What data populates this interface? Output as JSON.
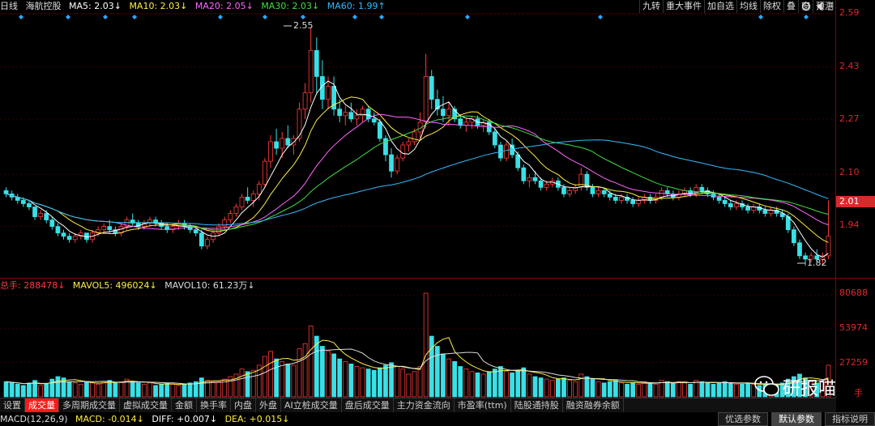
{
  "header": {
    "period": "日线",
    "stock_name": "海航控股",
    "ma5": "MA5: 2.03↓",
    "ma10": "MA10: 2.03↓",
    "ma20": "MA20: 2.05↓",
    "ma30": "MA30: 2.03↓",
    "ma60": "MA60: 1.99↑"
  },
  "tools": [
    "九转",
    "重大事件",
    "加自选",
    "均线",
    "除权",
    "叠",
    "窗",
    "预测"
  ],
  "price_axis": [
    "2.59",
    "2.43",
    "2.27",
    "2.10",
    "1.94"
  ],
  "current_price": "2.01",
  "annotations": {
    "high": "2.55",
    "low": "1.82"
  },
  "volume_header": {
    "total": "总手: 288478↓",
    "mavol5": "MAVOL5: 496024↓",
    "mavol10": "MAVOL10: 61.23万↓"
  },
  "volume_axis": [
    "80688",
    "53974",
    "27259",
    "手"
  ],
  "tabs": [
    "设置",
    "成交量",
    "多周期成交量",
    "虚拟成交量",
    "金额",
    "换手率",
    "内盘",
    "外盘",
    "AI立桩成交量",
    "盘后成交量",
    "主力资金流向",
    "市盈率(ttm)",
    "陆股通持股",
    "融资融券余额"
  ],
  "active_tab": "成交量",
  "macd": {
    "label": "MACD(12,26,9)",
    "macd": "MACD: -0.014↓",
    "diff": "DIFF: +0.007↓",
    "dea": "DEA: +0.015↓"
  },
  "bottom_buttons": [
    "优选参数",
    "默认参数",
    "指标说明"
  ],
  "watermark": "研报喵",
  "colors": {
    "up": "#ff3b3b",
    "down": "#39e0e6",
    "ma5": "#ffffff",
    "ma10": "#ffee44",
    "ma20": "#ff66ff",
    "ma30": "#44dd44",
    "ma60": "#33bbff"
  },
  "chart_data": {
    "type": "candlestick",
    "price_range": [
      1.8,
      2.59
    ],
    "volume_range": [
      0,
      82000
    ],
    "candles": [
      [
        2.05,
        2.06,
        2.03,
        2.04,
        12000
      ],
      [
        2.04,
        2.05,
        2.02,
        2.03,
        11000
      ],
      [
        2.03,
        2.04,
        2.01,
        2.02,
        10000
      ],
      [
        2.02,
        2.03,
        2.0,
        2.01,
        9000
      ],
      [
        2.01,
        2.02,
        1.99,
        2.0,
        11000
      ],
      [
        2.0,
        2.0,
        1.96,
        1.97,
        13000
      ],
      [
        1.97,
        1.99,
        1.96,
        1.98,
        9000
      ],
      [
        1.98,
        1.99,
        1.95,
        1.96,
        10000
      ],
      [
        1.96,
        1.97,
        1.93,
        1.94,
        14000
      ],
      [
        1.94,
        1.95,
        1.91,
        1.92,
        16000
      ],
      [
        1.92,
        1.93,
        1.9,
        1.91,
        15000
      ],
      [
        1.91,
        1.92,
        1.89,
        1.9,
        12000
      ],
      [
        1.9,
        1.92,
        1.89,
        1.91,
        11000
      ],
      [
        1.91,
        1.93,
        1.9,
        1.92,
        10000
      ],
      [
        1.92,
        1.92,
        1.89,
        1.9,
        12000
      ],
      [
        1.9,
        1.93,
        1.89,
        1.92,
        11000
      ],
      [
        1.92,
        1.94,
        1.91,
        1.93,
        10000
      ],
      [
        1.93,
        1.95,
        1.92,
        1.94,
        12000
      ],
      [
        1.94,
        1.96,
        1.92,
        1.93,
        13000
      ],
      [
        1.93,
        1.94,
        1.91,
        1.92,
        11000
      ],
      [
        1.92,
        1.95,
        1.91,
        1.94,
        12000
      ],
      [
        1.94,
        1.97,
        1.93,
        1.96,
        14000
      ],
      [
        1.96,
        1.98,
        1.94,
        1.95,
        12000
      ],
      [
        1.95,
        1.96,
        1.93,
        1.94,
        11000
      ],
      [
        1.94,
        1.96,
        1.93,
        1.95,
        10000
      ],
      [
        1.95,
        1.97,
        1.94,
        1.96,
        11000
      ],
      [
        1.96,
        1.97,
        1.94,
        1.95,
        9000
      ],
      [
        1.95,
        1.96,
        1.93,
        1.94,
        10000
      ],
      [
        1.94,
        1.95,
        1.92,
        1.93,
        11000
      ],
      [
        1.93,
        1.95,
        1.92,
        1.94,
        10000
      ],
      [
        1.94,
        1.96,
        1.93,
        1.95,
        9000
      ],
      [
        1.95,
        1.96,
        1.93,
        1.94,
        10000
      ],
      [
        1.94,
        1.95,
        1.92,
        1.93,
        11000
      ],
      [
        1.93,
        1.94,
        1.91,
        1.92,
        12000
      ],
      [
        1.92,
        1.93,
        1.87,
        1.88,
        15000
      ],
      [
        1.88,
        1.91,
        1.87,
        1.9,
        13000
      ],
      [
        1.9,
        1.93,
        1.89,
        1.92,
        12000
      ],
      [
        1.92,
        1.95,
        1.91,
        1.94,
        12000
      ],
      [
        1.94,
        1.97,
        1.93,
        1.96,
        14000
      ],
      [
        1.96,
        1.99,
        1.95,
        1.98,
        16000
      ],
      [
        1.98,
        2.01,
        1.97,
        2.0,
        18000
      ],
      [
        2.0,
        2.04,
        1.99,
        2.03,
        22000
      ],
      [
        2.03,
        2.06,
        2.01,
        2.02,
        20000
      ],
      [
        2.02,
        2.05,
        2.0,
        2.04,
        21000
      ],
      [
        2.04,
        2.08,
        2.02,
        2.07,
        25000
      ],
      [
        2.07,
        2.15,
        2.06,
        2.14,
        32000
      ],
      [
        2.14,
        2.22,
        2.12,
        2.2,
        36000
      ],
      [
        2.2,
        2.24,
        2.16,
        2.18,
        30000
      ],
      [
        2.18,
        2.23,
        2.15,
        2.21,
        28000
      ],
      [
        2.21,
        2.25,
        2.18,
        2.19,
        26000
      ],
      [
        2.19,
        2.22,
        2.16,
        2.21,
        25000
      ],
      [
        2.21,
        2.32,
        2.2,
        2.3,
        38000
      ],
      [
        2.3,
        2.38,
        2.27,
        2.35,
        42000
      ],
      [
        2.35,
        2.55,
        2.32,
        2.48,
        56000
      ],
      [
        2.48,
        2.52,
        2.35,
        2.4,
        48000
      ],
      [
        2.4,
        2.45,
        2.3,
        2.33,
        40000
      ],
      [
        2.33,
        2.4,
        2.3,
        2.37,
        36000
      ],
      [
        2.37,
        2.4,
        2.28,
        2.3,
        34000
      ],
      [
        2.3,
        2.33,
        2.26,
        2.28,
        30000
      ],
      [
        2.28,
        2.31,
        2.25,
        2.29,
        28000
      ],
      [
        2.29,
        2.32,
        2.26,
        2.27,
        26000
      ],
      [
        2.27,
        2.3,
        2.25,
        2.28,
        24000
      ],
      [
        2.28,
        2.31,
        2.26,
        2.3,
        23000
      ],
      [
        2.3,
        2.31,
        2.26,
        2.27,
        22000
      ],
      [
        2.27,
        2.29,
        2.25,
        2.26,
        21000
      ],
      [
        2.26,
        2.27,
        2.2,
        2.21,
        23000
      ],
      [
        2.21,
        2.22,
        2.14,
        2.16,
        25000
      ],
      [
        2.16,
        2.18,
        2.09,
        2.11,
        27000
      ],
      [
        2.11,
        2.16,
        2.1,
        2.15,
        24000
      ],
      [
        2.15,
        2.2,
        2.14,
        2.19,
        22000
      ],
      [
        2.19,
        2.21,
        2.17,
        2.2,
        18000
      ],
      [
        2.2,
        2.24,
        2.19,
        2.23,
        20000
      ],
      [
        2.23,
        2.29,
        2.21,
        2.26,
        24000
      ],
      [
        2.26,
        2.47,
        2.24,
        2.4,
        82000
      ],
      [
        2.4,
        2.42,
        2.3,
        2.33,
        48000
      ],
      [
        2.33,
        2.36,
        2.28,
        2.3,
        40000
      ],
      [
        2.3,
        2.34,
        2.26,
        2.28,
        34000
      ],
      [
        2.28,
        2.32,
        2.25,
        2.3,
        30000
      ],
      [
        2.3,
        2.31,
        2.26,
        2.27,
        28000
      ],
      [
        2.27,
        2.28,
        2.24,
        2.25,
        24000
      ],
      [
        2.25,
        2.27,
        2.23,
        2.26,
        22000
      ],
      [
        2.26,
        2.28,
        2.24,
        2.27,
        20000
      ],
      [
        2.27,
        2.28,
        2.24,
        2.25,
        19000
      ],
      [
        2.25,
        2.27,
        2.23,
        2.26,
        18000
      ],
      [
        2.26,
        2.27,
        2.22,
        2.23,
        20000
      ],
      [
        2.23,
        2.24,
        2.18,
        2.19,
        22000
      ],
      [
        2.19,
        2.2,
        2.14,
        2.15,
        24000
      ],
      [
        2.15,
        2.2,
        2.14,
        2.19,
        20000
      ],
      [
        2.19,
        2.21,
        2.15,
        2.16,
        19000
      ],
      [
        2.16,
        2.17,
        2.11,
        2.12,
        21000
      ],
      [
        2.12,
        2.13,
        2.07,
        2.08,
        23000
      ],
      [
        2.08,
        2.1,
        2.06,
        2.09,
        18000
      ],
      [
        2.09,
        2.11,
        2.07,
        2.08,
        16000
      ],
      [
        2.08,
        2.09,
        2.05,
        2.06,
        15000
      ],
      [
        2.06,
        2.08,
        2.05,
        2.07,
        14000
      ],
      [
        2.07,
        2.09,
        2.06,
        2.08,
        13000
      ],
      [
        2.08,
        2.09,
        2.05,
        2.06,
        14000
      ],
      [
        2.06,
        2.07,
        2.03,
        2.04,
        15000
      ],
      [
        2.04,
        2.06,
        2.03,
        2.05,
        13000
      ],
      [
        2.05,
        2.07,
        2.04,
        2.06,
        12000
      ],
      [
        2.06,
        2.12,
        2.05,
        2.1,
        18000
      ],
      [
        2.1,
        2.11,
        2.05,
        2.06,
        16000
      ],
      [
        2.06,
        2.07,
        2.03,
        2.04,
        14000
      ],
      [
        2.04,
        2.06,
        2.03,
        2.05,
        12000
      ],
      [
        2.05,
        2.06,
        2.03,
        2.04,
        11000
      ],
      [
        2.04,
        2.05,
        2.02,
        2.03,
        12000
      ],
      [
        2.03,
        2.04,
        2.01,
        2.02,
        13000
      ],
      [
        2.02,
        2.04,
        2.01,
        2.03,
        11000
      ],
      [
        2.03,
        2.04,
        2.01,
        2.02,
        10000
      ],
      [
        2.02,
        2.03,
        2.0,
        2.01,
        11000
      ],
      [
        2.01,
        2.03,
        2.0,
        2.02,
        10000
      ],
      [
        2.02,
        2.04,
        2.01,
        2.03,
        12000
      ],
      [
        2.03,
        2.04,
        2.01,
        2.02,
        11000
      ],
      [
        2.02,
        2.04,
        2.01,
        2.03,
        10000
      ],
      [
        2.03,
        2.06,
        2.02,
        2.05,
        13000
      ],
      [
        2.05,
        2.06,
        2.03,
        2.04,
        12000
      ],
      [
        2.04,
        2.05,
        2.02,
        2.03,
        11000
      ],
      [
        2.03,
        2.05,
        2.02,
        2.04,
        12000
      ],
      [
        2.04,
        2.06,
        2.03,
        2.05,
        11000
      ],
      [
        2.05,
        2.06,
        2.03,
        2.04,
        10000
      ],
      [
        2.04,
        2.07,
        2.03,
        2.06,
        13000
      ],
      [
        2.06,
        2.07,
        2.04,
        2.05,
        12000
      ],
      [
        2.05,
        2.06,
        2.03,
        2.04,
        11000
      ],
      [
        2.04,
        2.05,
        2.02,
        2.03,
        10000
      ],
      [
        2.03,
        2.04,
        2.01,
        2.02,
        11000
      ],
      [
        2.02,
        2.03,
        2.0,
        2.01,
        12000
      ],
      [
        2.01,
        2.02,
        1.99,
        2.0,
        11000
      ],
      [
        2.0,
        2.02,
        1.99,
        2.01,
        10000
      ],
      [
        2.01,
        2.02,
        1.99,
        2.0,
        10000
      ],
      [
        2.0,
        2.01,
        1.98,
        1.99,
        11000
      ],
      [
        1.99,
        2.01,
        1.98,
        2.0,
        10000
      ],
      [
        2.0,
        2.01,
        1.98,
        1.99,
        9000
      ],
      [
        1.99,
        2.0,
        1.97,
        1.98,
        10000
      ],
      [
        1.98,
        2.0,
        1.97,
        1.99,
        9000
      ],
      [
        1.99,
        2.0,
        1.97,
        1.98,
        10000
      ],
      [
        1.98,
        1.99,
        1.96,
        1.97,
        11000
      ],
      [
        1.97,
        1.98,
        1.92,
        1.93,
        14000
      ],
      [
        1.93,
        1.94,
        1.88,
        1.89,
        16000
      ],
      [
        1.89,
        1.9,
        1.84,
        1.85,
        18000
      ],
      [
        1.85,
        1.86,
        1.82,
        1.84,
        15000
      ],
      [
        1.84,
        1.86,
        1.83,
        1.85,
        12000
      ],
      [
        1.85,
        1.87,
        1.83,
        1.84,
        11000
      ],
      [
        1.84,
        1.86,
        1.82,
        1.85,
        12000
      ],
      [
        1.85,
        2.02,
        1.84,
        1.91,
        25000
      ]
    ]
  }
}
